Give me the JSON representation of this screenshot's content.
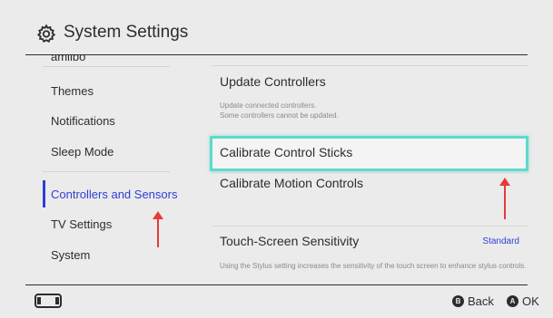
{
  "header": {
    "title": "System Settings",
    "icon": "gear-icon"
  },
  "sidebar": {
    "cut_item": "amiibo",
    "items": [
      {
        "label": "Themes",
        "active": false
      },
      {
        "label": "Notifications",
        "active": false
      },
      {
        "label": "Sleep Mode",
        "active": false
      },
      {
        "label": "Controllers and Sensors",
        "active": true
      },
      {
        "label": "TV Settings",
        "active": false
      },
      {
        "label": "System",
        "active": false
      }
    ]
  },
  "panel": {
    "update_controllers": {
      "title": "Update Controllers",
      "desc_line1": "Update connected controllers.",
      "desc_line2": "Some controllers cannot be updated."
    },
    "calibrate_sticks": {
      "title": "Calibrate Control Sticks"
    },
    "calibrate_motion": {
      "title": "Calibrate Motion Controls"
    },
    "touch_sensitivity": {
      "title": "Touch-Screen Sensitivity",
      "value": "Standard",
      "desc": "Using the Stylus setting increases the sensitivity of the touch screen to enhance stylus controls."
    }
  },
  "footer": {
    "console_icon": "console-icon",
    "back_button": {
      "glyph": "B",
      "label": "Back"
    },
    "ok_button": {
      "glyph": "A",
      "label": "OK"
    }
  },
  "colors": {
    "accent": "#2e3fd6",
    "focus": "#5fd9cc",
    "annotation_arrow": "#e53b3b",
    "background": "#ebebeb"
  }
}
